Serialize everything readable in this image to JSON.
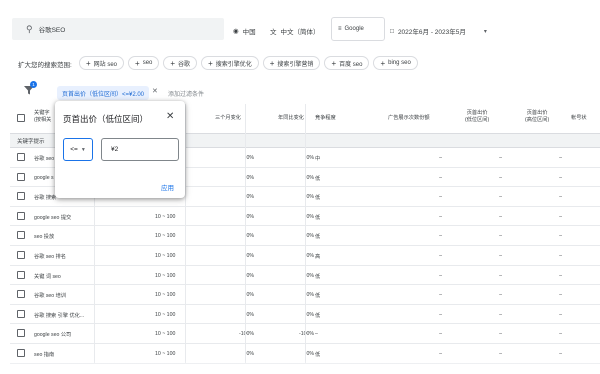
{
  "top_bar": {
    "search_value": "谷歌SEO",
    "location": "中国",
    "language": "中文（简体）",
    "engine": "Google",
    "date_range": "2022年6月 - 2023年5月"
  },
  "expand": {
    "label": "扩大您的搜索范围:",
    "chips": [
      "网站 seo",
      "seo",
      "谷歌",
      "搜索引擎优化",
      "搜索引擎营销",
      "百度 seo",
      "bing seo"
    ]
  },
  "filter": {
    "badge_count": "1",
    "active_filter": "页首出价（低位区间）<=¥2.00",
    "add_filter_label": "添加过滤条件"
  },
  "table": {
    "headers": {
      "keyword_line1": "关键字",
      "keyword_line2": "(按相关",
      "three_month": "三个月变化",
      "yoy": "年同比变化",
      "competition": "竞争程度",
      "ad_share": "广告展示次数份额",
      "bid_low_1": "页首出价",
      "bid_low_2": "(低位区间)",
      "bid_high_1": "页首出价",
      "bid_high_2": "(高位区间)",
      "account_status": "帐号状"
    },
    "section_label": "关键字提示",
    "rows": [
      {
        "keyword": "谷歌 seo",
        "avg": "",
        "three_month": "0%",
        "yoy": "0%",
        "competition": "中",
        "ad_share": "–",
        "bid_low": "–",
        "bid_high": "–"
      },
      {
        "keyword": "google s",
        "avg": "",
        "three_month": "0%",
        "yoy": "0%",
        "competition": "低",
        "ad_share": "–",
        "bid_low": "–",
        "bid_high": "–"
      },
      {
        "keyword": "谷歌 搜索",
        "avg": "",
        "three_month": "0%",
        "yoy": "0%",
        "competition": "低",
        "ad_share": "–",
        "bid_low": "–",
        "bid_high": "–"
      },
      {
        "keyword": "google seo 提交",
        "avg": "10 ~ 100",
        "three_month": "0%",
        "yoy": "0%",
        "competition": "低",
        "ad_share": "–",
        "bid_low": "–",
        "bid_high": "–"
      },
      {
        "keyword": "seo 投放",
        "avg": "10 ~ 100",
        "three_month": "0%",
        "yoy": "0%",
        "competition": "低",
        "ad_share": "–",
        "bid_low": "–",
        "bid_high": "–"
      },
      {
        "keyword": "谷歌 seo 排名",
        "avg": "10 ~ 100",
        "three_month": "0%",
        "yoy": "0%",
        "competition": "高",
        "ad_share": "–",
        "bid_low": "–",
        "bid_high": "–"
      },
      {
        "keyword": "关键 词 seo",
        "avg": "10 ~ 100",
        "three_month": "0%",
        "yoy": "0%",
        "competition": "低",
        "ad_share": "–",
        "bid_low": "–",
        "bid_high": "–"
      },
      {
        "keyword": "谷歌 seo 培训",
        "avg": "10 ~ 100",
        "three_month": "0%",
        "yoy": "0%",
        "competition": "低",
        "ad_share": "–",
        "bid_low": "–",
        "bid_high": "–"
      },
      {
        "keyword": "谷歌 搜索 引擎 优化...",
        "avg": "10 ~ 100",
        "three_month": "0%",
        "yoy": "0%",
        "competition": "低",
        "ad_share": "–",
        "bid_low": "–",
        "bid_high": "–"
      },
      {
        "keyword": "google seo 公司",
        "avg": "10 ~ 100",
        "three_month": "-100%",
        "yoy": "-100%",
        "competition": "–",
        "ad_share": "–",
        "bid_low": "–",
        "bid_high": "–"
      },
      {
        "keyword": "seo 指南",
        "avg": "10 ~ 100",
        "three_month": "0%",
        "yoy": "0%",
        "competition": "低",
        "ad_share": "–",
        "bid_low": "–",
        "bid_high": "–"
      }
    ]
  },
  "popup": {
    "title": "页首出价（低位区间）",
    "operator": "<=",
    "value": "¥2",
    "apply_label": "应用"
  }
}
